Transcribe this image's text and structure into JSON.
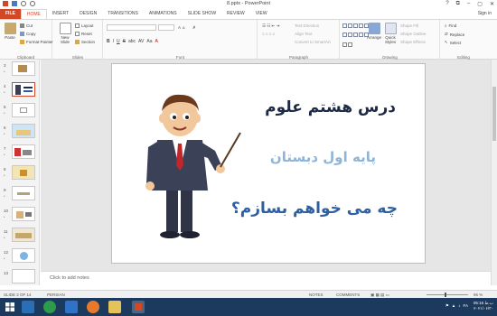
{
  "window": {
    "title": "8.pptx - PowerPoint",
    "minimize": "–",
    "maximize": "▢",
    "close": "✕",
    "help": "?",
    "restore": "⧉"
  },
  "tabs": [
    "FILE",
    "HOME",
    "INSERT",
    "DESIGN",
    "TRANSITIONS",
    "ANIMATIONS",
    "SLIDE SHOW",
    "REVIEW",
    "VIEW"
  ],
  "active_tab": "HOME",
  "sign_in": "Sign in",
  "ribbon": {
    "clipboard": {
      "label": "Clipboard",
      "paste": "Paste",
      "cut": "Cut",
      "copy": "Copy",
      "format_painter": "Format Painter"
    },
    "slides": {
      "label": "Slides",
      "new_slide": "New Slide",
      "layout": "Layout",
      "reset": "Reset",
      "section": "Section"
    },
    "font": {
      "label": "Font",
      "font_name": "",
      "font_size": "",
      "bold": "B",
      "italic": "I",
      "underline": "U",
      "strike": "S",
      "shadow": "abc",
      "char_spacing": "AV",
      "case": "Aa",
      "color": "A"
    },
    "paragraph": {
      "label": "Paragraph",
      "text_direction": "Text Direction",
      "align_text": "Align Text",
      "convert_smartart": "Convert to SmartArt"
    },
    "drawing": {
      "label": "Drawing",
      "arrange": "Arrange",
      "quick_styles": "Quick Styles",
      "shape_fill": "Shape Fill",
      "shape_outline": "Shape Outline",
      "shape_effects": "Shape Effects"
    },
    "editing": {
      "label": "Editing",
      "find": "Find",
      "replace": "Replace",
      "select": "Select"
    }
  },
  "thumbnails": [
    {
      "num": "3",
      "star": "*"
    },
    {
      "num": "4",
      "star": "*"
    },
    {
      "num": "5",
      "star": "*"
    },
    {
      "num": "6",
      "star": "*"
    },
    {
      "num": "7",
      "star": "*"
    },
    {
      "num": "8",
      "star": "*"
    },
    {
      "num": "9",
      "star": "*"
    },
    {
      "num": "10",
      "star": "*"
    },
    {
      "num": "11",
      "star": "*"
    },
    {
      "num": "12",
      "star": "*"
    },
    {
      "num": "13",
      "star": ""
    }
  ],
  "slide": {
    "line1": "درس هشتم علوم",
    "line2": "پایه اول دبستان",
    "line3": "چه می خواهم بسازم؟"
  },
  "notes_placeholder": "Click to add notes",
  "status": {
    "slide_info": "SLIDE 2 OF 14",
    "language": "PERSIAN",
    "notes": "NOTES",
    "comments": "COMMENTS",
    "zoom": "96 %"
  },
  "taskbar": {
    "time": "05:16 ب.ظ",
    "date": "۲۰۲۱/۰۶/۳۰",
    "lang": "FA"
  },
  "colors": {
    "accent": "#d24726",
    "taskbar": "#1c3a5e",
    "title1": "#1f2a44",
    "title2": "#8fb4d9",
    "title3": "#2d5fa3"
  }
}
